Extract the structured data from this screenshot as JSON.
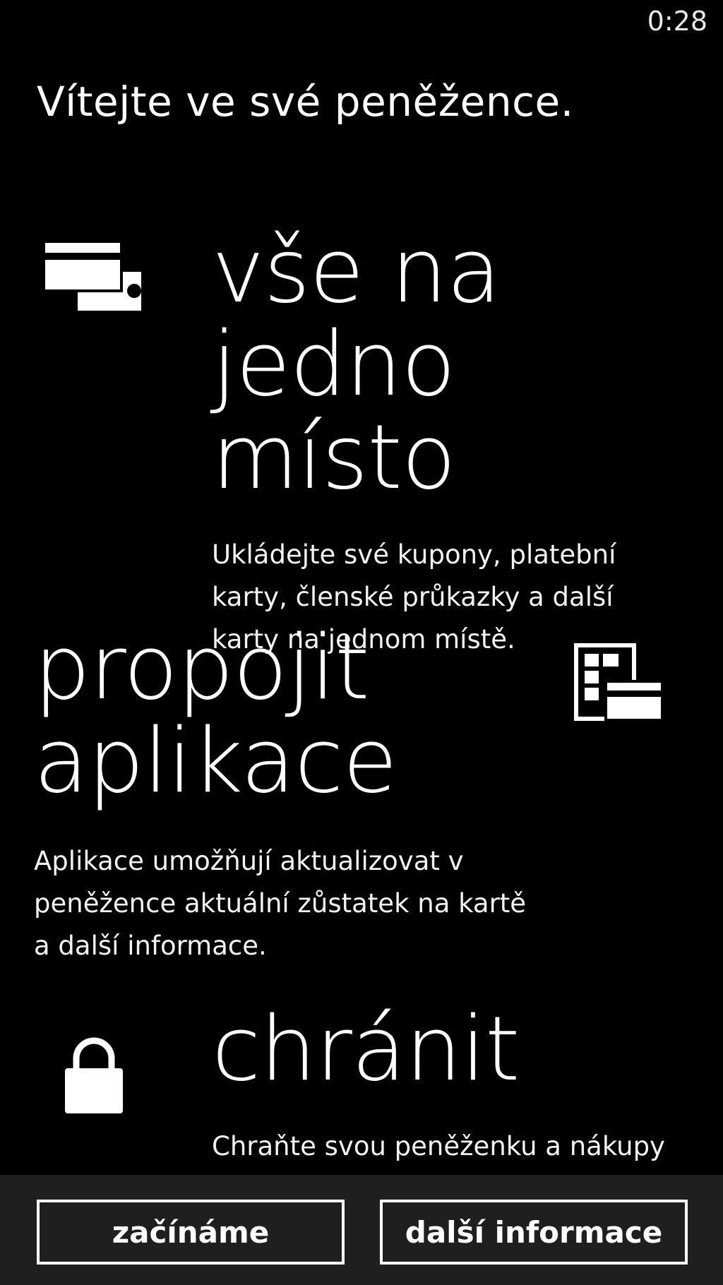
{
  "status": {
    "time": "0:28"
  },
  "welcome": "Vítejte ve své peněžence.",
  "sections": [
    {
      "icon": "cards-icon",
      "title": "vše na jedno\nmísto",
      "text": "Ukládejte své kupony, platební\nkarty, členské průkazky a další\nkarty na jednom místě."
    },
    {
      "icon": "app-card-icon",
      "title": "propojit\naplikace",
      "text": "Aplikace umožňují aktualizovat v\npeněžence aktuální zůstatek na kartě\na další informace."
    },
    {
      "icon": "lock-icon",
      "title": "chránit",
      "text": "Chraňte svou peněženku a nákupy"
    }
  ],
  "buttons": {
    "start": "začínáme",
    "more": "další informace"
  }
}
